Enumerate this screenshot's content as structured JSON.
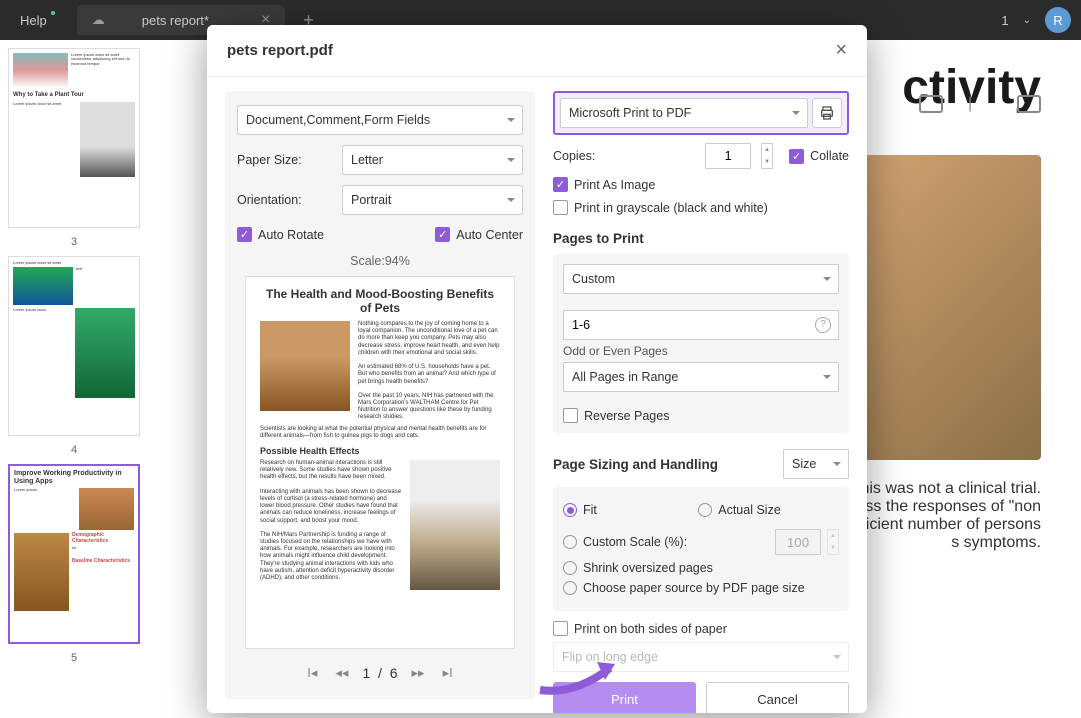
{
  "topbar": {
    "help": "Help",
    "tab_title": "pets report*",
    "user_count": "1",
    "avatar": "R"
  },
  "bg": {
    "h1": "ctivity",
    "para1": "this was not a clinical trial.",
    "para2": "ess the responses of \"non",
    "para3": "fficient number of persons",
    "para4": "s symptoms.",
    "thumbs": {
      "n3": "3",
      "n4": "4",
      "n5": "5"
    },
    "thumb3_title": "Why to Take a Plant Tour",
    "thumb5_title": "Improve Working Productivity in Using Apps",
    "thumb5_sub1": "Demographic Characteristics",
    "thumb5_sub2": "Baseline Characteristics"
  },
  "modal": {
    "title": "pets report.pdf",
    "print_options": "Document,Comment,Form Fields",
    "paper_size_label": "Paper Size:",
    "paper_size": "Letter",
    "orientation_label": "Orientation:",
    "orientation": "Portrait",
    "auto_rotate": "Auto Rotate",
    "auto_center": "Auto Center",
    "scale": "Scale:94%",
    "preview": {
      "title": "The Health and Mood-Boosting Benefits of Pets",
      "subtitle": "Possible Health Effects"
    },
    "pager": {
      "current": "1",
      "sep": "/",
      "total": "6"
    },
    "printer": "Microsoft Print to PDF",
    "copies_label": "Copies:",
    "copies": "1",
    "collate": "Collate",
    "print_as_image": "Print As Image",
    "print_grayscale": "Print in grayscale (black and white)",
    "pages_to_print": "Pages to Print",
    "pages_mode": "Custom",
    "pages_range": "1-6",
    "odd_even_label": "Odd or Even Pages",
    "odd_even": "All Pages in Range",
    "reverse": "Reverse Pages",
    "psh_title": "Page Sizing and Handling",
    "psh_size": "Size",
    "fit": "Fit",
    "actual": "Actual Size",
    "custom_scale": "Custom Scale (%):",
    "custom_scale_value": "100",
    "shrink": "Shrink oversized pages",
    "choose_source": "Choose paper source by PDF page size",
    "both_sides": "Print on both sides of paper",
    "flip": "Flip on long edge",
    "print_btn": "Print",
    "cancel_btn": "Cancel"
  }
}
